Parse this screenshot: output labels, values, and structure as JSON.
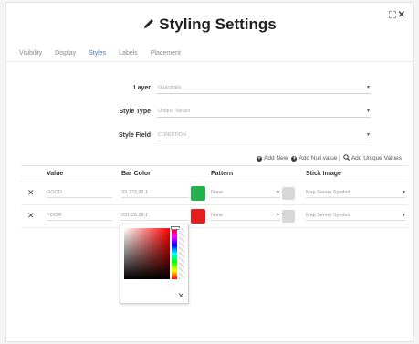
{
  "header": {
    "title": "Styling Settings",
    "controls": [
      "expand-icon",
      "close-icon"
    ]
  },
  "tabs": [
    {
      "label": "Visibility",
      "active": false
    },
    {
      "label": "Display",
      "active": false
    },
    {
      "label": "Styles",
      "active": true
    },
    {
      "label": "Labels",
      "active": false
    },
    {
      "label": "Placement",
      "active": false
    }
  ],
  "form": {
    "layer": {
      "label": "Layer",
      "value": "Guardrails"
    },
    "style_type": {
      "label": "Style Type",
      "value": "Unique Values"
    },
    "style_field": {
      "label": "Style Field",
      "value": "CONDITION"
    }
  },
  "actions": {
    "add_new": "Add New",
    "add_null": "Add Null value |",
    "add_unique": "Add Unique Values"
  },
  "table": {
    "headers": [
      "Value",
      "Bar Color",
      "Pattern",
      "Stick Image"
    ],
    "rows": [
      {
        "value": "GOOD",
        "bar_color": "33,173,93,1",
        "swatch": "#22b14c",
        "pattern": "None",
        "stick_image": "Map Server Symbol"
      },
      {
        "value": "POOR",
        "bar_color": "231,28,28,1",
        "swatch": "#e71c1c",
        "pattern": "None",
        "stick_image": "Map Server Symbol"
      }
    ]
  },
  "colors": {
    "accent": "#4a78b6",
    "good": "#22b14c",
    "poor": "#e71c1c"
  }
}
